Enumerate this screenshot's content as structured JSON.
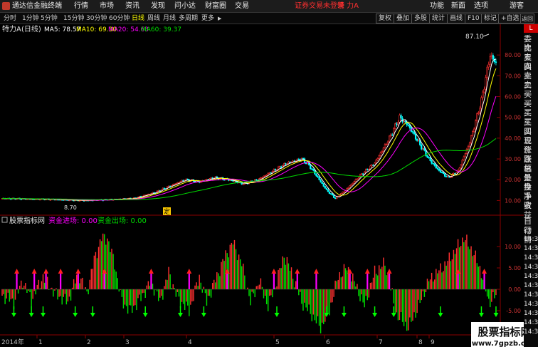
{
  "app": {
    "title": "通达信金融终端",
    "menu": [
      "行情",
      "市场",
      "资讯",
      "发现",
      "问小达",
      "财富圈",
      "交易"
    ],
    "login_status": "证券交易未登录",
    "stock_name": "特 力A",
    "right_menu": [
      "功能",
      "新面",
      "选项"
    ],
    "user": "游客",
    "window_controls": [
      "−",
      "□",
      "×"
    ]
  },
  "toolbar": {
    "periods": [
      "分时",
      "1分钟",
      "5分钟",
      "15分钟",
      "30分钟",
      "60分钟",
      "日线",
      "周线",
      "月线",
      "多周期",
      "更多"
    ],
    "active_period": "日线",
    "more_arrow": "▶",
    "actions": [
      "复权",
      "叠加",
      "多股",
      "统计",
      "画线",
      "F10",
      "标记",
      "+自选",
      "返回"
    ]
  },
  "main_chart": {
    "header_name": "特力A",
    "header_period": "(日线)",
    "ma": [
      {
        "label": "MA5: 78.57",
        "color": "#ffffff"
      },
      {
        "label": "MA10: 69.30",
        "color": "#ffff00"
      },
      {
        "label": "MA20: 54.63",
        "color": "#ff00ff"
      },
      {
        "label": "MA60: 39.37",
        "color": "#00dd00"
      }
    ],
    "peak_label": "87.10",
    "low_label": "8.70",
    "marker_label": "定"
  },
  "indicator": {
    "name": "股票指标网",
    "in_label": "资金进场: 0.00",
    "out_label": "资金出场: 0.00",
    "in_color": "#ff00ff",
    "out_color": "#00dd00"
  },
  "timeline": {
    "year_label": "2014年",
    "months": [
      "1",
      "2",
      "3",
      "4",
      "5",
      "6",
      "7",
      "8",
      "9"
    ]
  },
  "right_panel": {
    "corner": "L",
    "items_top": [
      "委比",
      "卖五",
      "卖四",
      "卖三",
      "卖二",
      "卖一",
      "买一",
      "买二",
      "买三",
      "买四",
      "买五",
      "现价",
      "涨跌",
      "涨幅",
      "总量",
      "外盘",
      "换手",
      "净资",
      "收益"
    ],
    "items_bottom": [
      "自动",
      "行情",
      "14:34",
      "14:35",
      "14:35",
      "14:35",
      "14:35",
      "14:35",
      "14:35",
      "14:35",
      "14:35",
      "14:35",
      "14:35"
    ]
  },
  "watermark": {
    "line1": "股票指标网",
    "line2": "www.7gpzb.com"
  },
  "chart_data": [
    {
      "type": "candlestick",
      "title": "特力A (日线)",
      "yticks": [
        10,
        20,
        30,
        40,
        50,
        60,
        70,
        80
      ],
      "ylim": [
        5,
        90
      ],
      "months": [
        "1",
        "2",
        "3",
        "4",
        "5",
        "6",
        "7",
        "8",
        "9"
      ],
      "series": [
        {
          "name": "MA5: 78.57",
          "last": 78.57
        },
        {
          "name": "MA10: 69.30",
          "last": 69.3
        },
        {
          "name": "MA20: 54.63",
          "last": 54.63
        },
        {
          "name": "MA60: 39.37",
          "last": 39.37
        }
      ],
      "anchor_closes": [
        [
          0,
          11
        ],
        [
          35,
          10.5
        ],
        [
          55,
          10
        ],
        [
          75,
          10.5
        ],
        [
          90,
          11
        ],
        [
          105,
          14
        ],
        [
          115,
          17
        ],
        [
          125,
          20
        ],
        [
          135,
          19
        ],
        [
          145,
          21
        ],
        [
          155,
          20
        ],
        [
          165,
          18
        ],
        [
          175,
          20
        ],
        [
          185,
          24
        ],
        [
          195,
          28
        ],
        [
          205,
          30
        ],
        [
          210,
          27
        ],
        [
          215,
          22
        ],
        [
          222,
          15
        ],
        [
          228,
          11
        ],
        [
          235,
          15
        ],
        [
          245,
          22
        ],
        [
          255,
          28
        ],
        [
          265,
          40
        ],
        [
          272,
          50
        ],
        [
          278,
          46
        ],
        [
          285,
          38
        ],
        [
          292,
          30
        ],
        [
          298,
          25
        ],
        [
          305,
          21
        ],
        [
          312,
          24
        ],
        [
          320,
          38
        ],
        [
          328,
          58
        ],
        [
          334,
          80
        ],
        [
          338,
          76
        ]
      ],
      "high_price": 87.1,
      "low_price": 8.7
    },
    {
      "type": "bar",
      "title": "股票指标网",
      "yticks": [
        -5.0,
        0.0,
        5.0,
        10.0
      ],
      "ylim": [
        -10,
        14
      ],
      "series": [
        {
          "name": "资金进场: 0.00",
          "last": 0.0
        },
        {
          "name": "资金出场: 0.00",
          "last": 0.0
        }
      ],
      "anchor_values": [
        [
          0,
          -1.5
        ],
        [
          8,
          -3
        ],
        [
          14,
          2
        ],
        [
          20,
          -2.5
        ],
        [
          28,
          3
        ],
        [
          36,
          -1
        ],
        [
          45,
          -3
        ],
        [
          52,
          4
        ],
        [
          58,
          -1
        ],
        [
          63,
          7
        ],
        [
          68,
          12
        ],
        [
          72,
          12
        ],
        [
          77,
          6
        ],
        [
          82,
          -3
        ],
        [
          88,
          -5
        ],
        [
          95,
          -2
        ],
        [
          102,
          2
        ],
        [
          108,
          -3
        ],
        [
          114,
          4
        ],
        [
          120,
          -2
        ],
        [
          128,
          -5
        ],
        [
          135,
          3
        ],
        [
          140,
          -3
        ],
        [
          148,
          4
        ],
        [
          153,
          8
        ],
        [
          158,
          11
        ],
        [
          164,
          6
        ],
        [
          170,
          -3
        ],
        [
          176,
          2
        ],
        [
          182,
          -4
        ],
        [
          188,
          2
        ],
        [
          193,
          8
        ],
        [
          198,
          4
        ],
        [
          205,
          -3
        ],
        [
          212,
          -6
        ],
        [
          218,
          -9
        ],
        [
          224,
          -5
        ],
        [
          230,
          3
        ],
        [
          236,
          5
        ],
        [
          242,
          1
        ],
        [
          248,
          -4
        ],
        [
          255,
          4
        ],
        [
          262,
          6
        ],
        [
          270,
          -6
        ],
        [
          278,
          -9
        ],
        [
          285,
          -4
        ],
        [
          292,
          2
        ],
        [
          298,
          4
        ],
        [
          304,
          6
        ],
        [
          310,
          9
        ],
        [
          316,
          12
        ],
        [
          322,
          9
        ],
        [
          328,
          4
        ],
        [
          333,
          -3
        ],
        [
          338,
          -1.5
        ]
      ],
      "arrow_up_index": [
        10,
        22,
        30,
        40,
        52,
        70,
        102,
        128,
        154,
        186,
        202,
        215,
        238,
        250,
        265,
        312,
        330
      ],
      "arrow_down_index": [
        8,
        20,
        28,
        50,
        62,
        98,
        122,
        138,
        188,
        222,
        234,
        255,
        268,
        300,
        328,
        338
      ]
    }
  ]
}
